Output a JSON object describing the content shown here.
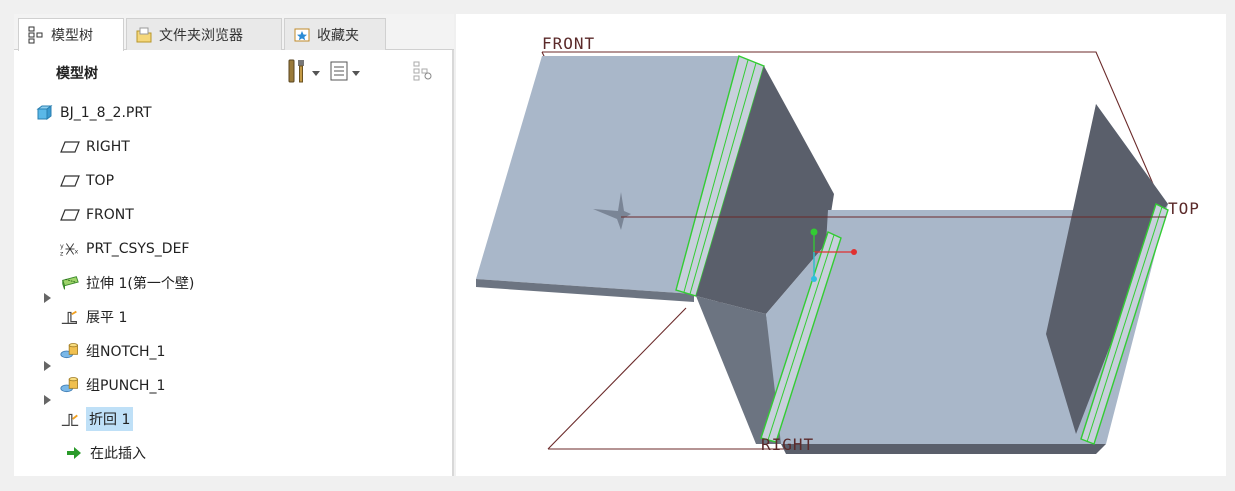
{
  "tabs": [
    {
      "label": "模型树",
      "icon": "model-tree-icon",
      "active": true
    },
    {
      "label": "文件夹浏览器",
      "icon": "folder-browser-icon",
      "active": false
    },
    {
      "label": "收藏夹",
      "icon": "favorites-icon",
      "active": false
    }
  ],
  "tree_header": {
    "title": "模型树",
    "settings_icon": "tools-icon",
    "show_icon": "list-icon",
    "filter_icon": "tree-filter-icon"
  },
  "tree": {
    "items": [
      {
        "label": "BJ_1_8_2.PRT",
        "icon": "part-icon"
      },
      {
        "label": "RIGHT",
        "icon": "datum-plane-icon"
      },
      {
        "label": "TOP",
        "icon": "datum-plane-icon"
      },
      {
        "label": "FRONT",
        "icon": "datum-plane-icon"
      },
      {
        "label": "PRT_CSYS_DEF",
        "icon": "csys-icon"
      },
      {
        "label": "拉伸 1(第一个壁)",
        "icon": "extrude-wall-icon",
        "expandable": true
      },
      {
        "label": "展平 1",
        "icon": "unbend-icon"
      },
      {
        "label": "组NOTCH_1",
        "icon": "group-icon",
        "expandable": true
      },
      {
        "label": "组PUNCH_1",
        "icon": "group-icon",
        "expandable": true
      },
      {
        "label": "折回 1",
        "icon": "bend-back-icon",
        "selected": true
      },
      {
        "label": "在此插入",
        "icon": "insert-here-icon"
      }
    ]
  },
  "viewport": {
    "datum_labels": {
      "front": "FRONT",
      "top": "TOP",
      "right": "RIGHT"
    }
  },
  "colors": {
    "selection": "#bfe0f7",
    "datum_plane": "#6b2a2a",
    "sheet_face": "#a9b7c9",
    "sheet_dark": "#5a5f6b",
    "highlight_edge": "#33cc33"
  }
}
